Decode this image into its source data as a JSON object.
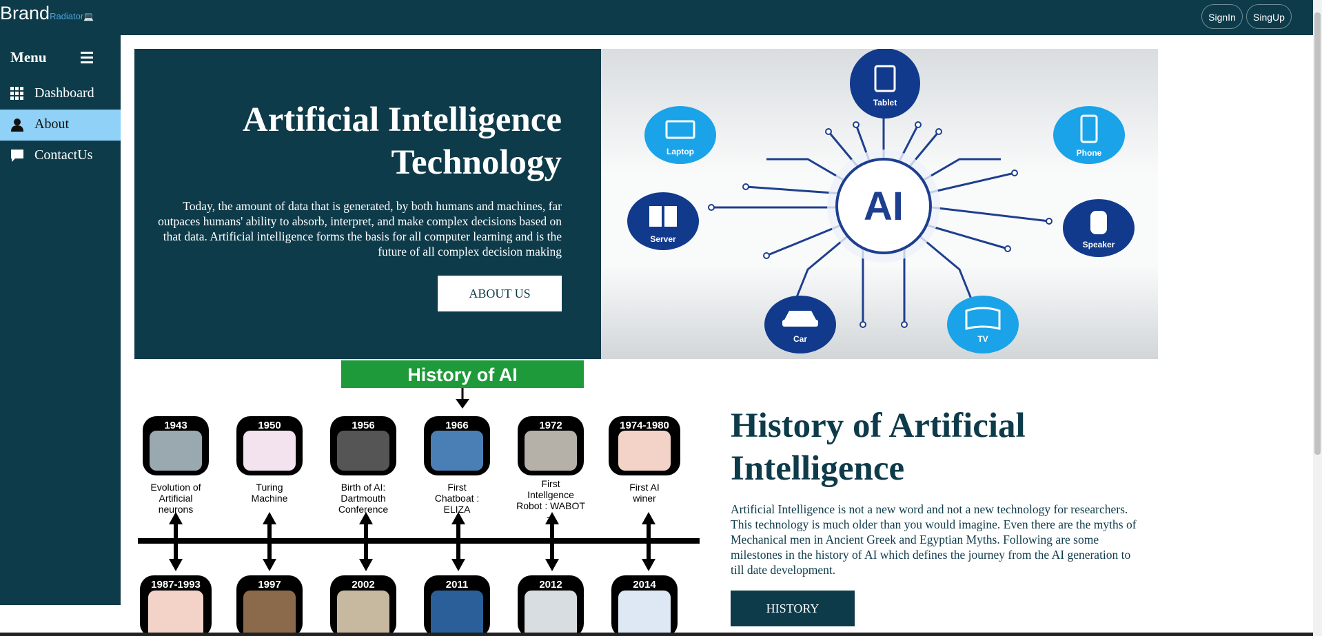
{
  "header": {
    "brand": "Brand",
    "brand_sub": "Radiator",
    "signin_label": "SignIn",
    "signup_label": "SingUp"
  },
  "sidebar": {
    "menu_label": "Menu",
    "items": [
      {
        "label": "Dashboard",
        "icon": "grid-icon",
        "active": false
      },
      {
        "label": "About",
        "icon": "user-icon",
        "active": true
      },
      {
        "label": "ContactUs",
        "icon": "chat-icon",
        "active": false
      }
    ]
  },
  "hero": {
    "title": "Artificial Intelligence Technology",
    "text": "Today, the amount of data that is generated, by both humans and machines, far outpaces humans' ability to absorb, interpret, and make complex decisions based on that data. Artificial intelligence forms the basis for all computer learning and is the future of all complex decision making",
    "button": "ABOUT US",
    "diagram": {
      "center": "AI",
      "nodes": [
        "Tablet",
        "Laptop",
        "Phone",
        "Server",
        "Speaker",
        "Car",
        "TV"
      ]
    }
  },
  "history": {
    "title": "History of Artificial Intelligence",
    "text": "Artificial Intelligence is not a new word and not a new technology for researchers. This technology is much older than you would imagine. Even there are the myths of Mechanical men in Ancient Greek and Egyptian Myths. Following are some milestones in the history of AI which defines the journey from the AI generation to till date development.",
    "button": "HISTORY",
    "timeline": {
      "banner": "History of AI",
      "top": [
        {
          "year": "1943",
          "caption": "Evolution of Artificial neurons"
        },
        {
          "year": "1950",
          "caption": "Turing Machine"
        },
        {
          "year": "1956",
          "caption": "Birth of AI: Dartmouth Conference"
        },
        {
          "year": "1966",
          "caption": "First Chatboat : ELIZA"
        },
        {
          "year": "1972",
          "caption": "First Intellgence Robot : WABOT -1"
        },
        {
          "year": "1974-1980",
          "caption": "First AI winer"
        }
      ],
      "bottom": [
        {
          "year": "1987-1993"
        },
        {
          "year": "1997"
        },
        {
          "year": "2002"
        },
        {
          "year": "2011"
        },
        {
          "year": "2012"
        },
        {
          "year": "2014"
        }
      ]
    }
  },
  "colors": {
    "primary": "#0e3b4a",
    "active_nav": "#8fd1f7",
    "accent_blue": "#1aa3e8",
    "navy": "#123a8c",
    "banner_green": "#1f9a3a"
  }
}
